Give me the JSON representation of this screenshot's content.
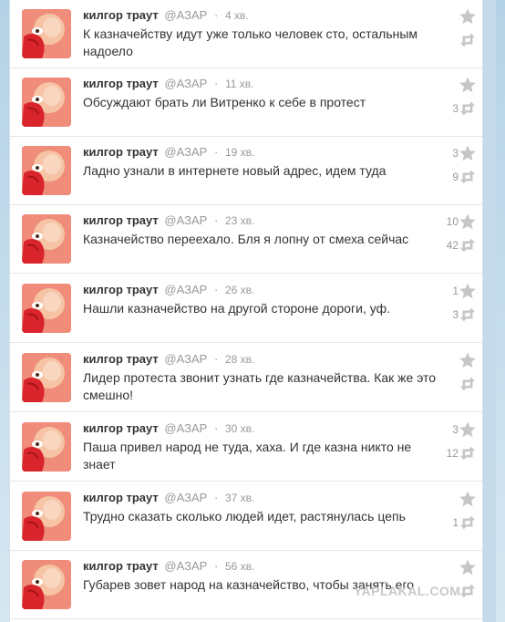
{
  "tweets": [
    {
      "name": "килгор траут",
      "handle": "@АЗАР",
      "time": "4 хв.",
      "text": "К казначейству идут уже только человек сто, остальным надоело",
      "favorites": "",
      "retweets": ""
    },
    {
      "name": "килгор траут",
      "handle": "@АЗАР",
      "time": "11 хв.",
      "text": "Обсуждают брать ли Витренко к себе в протест",
      "favorites": "",
      "retweets": "3"
    },
    {
      "name": "килгор траут",
      "handle": "@АЗАР",
      "time": "19 хв.",
      "text": "Ладно узнали в интернете новый адрес, идем туда",
      "favorites": "3",
      "retweets": "9"
    },
    {
      "name": "килгор траут",
      "handle": "@АЗАР",
      "time": "23 хв.",
      "text": "Казначейство переехало. Бля я лопну от смеха сейчас",
      "favorites": "10",
      "retweets": "42"
    },
    {
      "name": "килгор траут",
      "handle": "@АЗАР",
      "time": "26 хв.",
      "text": "Нашли казначейство на другой стороне дороги, уф.",
      "favorites": "1",
      "retweets": "3"
    },
    {
      "name": "килгор траут",
      "handle": "@АЗАР",
      "time": "28 хв.",
      "text": "Лидер протеста звонит узнать где казначейства. Как же это смешно!",
      "favorites": "",
      "retweets": ""
    },
    {
      "name": "килгор траут",
      "handle": "@АЗАР",
      "time": "30 хв.",
      "text": "Паша привел народ не туда, хаха. И где казна никто не знает",
      "favorites": "3",
      "retweets": "12"
    },
    {
      "name": "килгор траут",
      "handle": "@АЗАР",
      "time": "37 хв.",
      "text": "Трудно сказать сколько людей идет, растянулась цепь",
      "favorites": "",
      "retweets": "1"
    },
    {
      "name": "килгор траут",
      "handle": "@АЗАР",
      "time": "56 хв.",
      "text": "Губарев зовет народ на казначейство, чтобы занять его",
      "favorites": "",
      "retweets": ""
    }
  ],
  "separator": "·",
  "watermark": "YAPLAKAL.COM",
  "icons": {
    "favorite": "star-icon",
    "retweet": "retweet-icon"
  },
  "colors": {
    "icon": "#c6c6c6",
    "avatar_bg": "#f08c7a",
    "avatar_face": "#f6c3a5",
    "avatar_beard": "#d8242a"
  }
}
